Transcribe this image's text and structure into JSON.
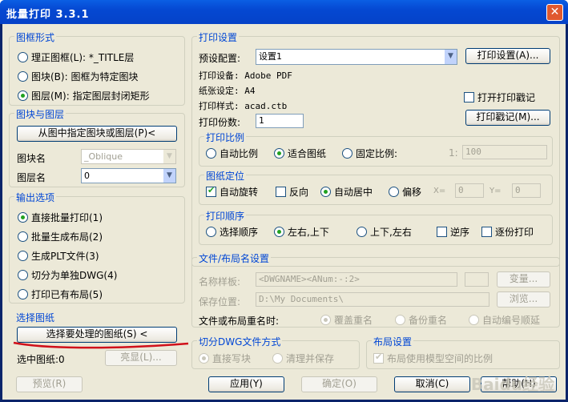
{
  "window": {
    "title": "批量打印 3.3.1",
    "close": "✕"
  },
  "frame": {
    "title": "图框形式",
    "options": [
      {
        "label": "理正图框(L): *_TITLE层",
        "checked": false
      },
      {
        "label": "图块(B): 图框为特定图块",
        "checked": false
      },
      {
        "label": "图层(M): 指定图层封闭矩形",
        "checked": true
      }
    ]
  },
  "block_layer": {
    "title": "图块与图层",
    "pick_button": "从图中指定图块或图层(P)<",
    "block_label": "图块名",
    "block_value": "_Oblique",
    "layer_label": "图层名",
    "layer_value": "0"
  },
  "output": {
    "title": "输出选项",
    "options": [
      {
        "label": "直接批量打印(1)",
        "checked": true
      },
      {
        "label": "批量生成布局(2)",
        "checked": false
      },
      {
        "label": "生成PLT文件(3)",
        "checked": false
      },
      {
        "label": "切分为单独DWG(4)",
        "checked": false
      },
      {
        "label": "打印已有布局(5)",
        "checked": false
      }
    ]
  },
  "select": {
    "title": "选择图纸",
    "select_button": "选择要处理的图纸(S) <",
    "selected_label": "选中图纸:0",
    "highlight_button": "亮显(L)..."
  },
  "print_settings": {
    "title": "打印设置",
    "preset_label": "预设配置:",
    "preset_value": "设置1",
    "settings_button": "打印设置(A)...",
    "device": "打印设备: Adobe PDF",
    "paper": "纸张设定: A4",
    "style": "打印样式: acad.ctb",
    "stamp_check": "打开打印戳记",
    "copies_label": "打印份数:",
    "copies_value": "1",
    "stamp_button": "打印戳记(M)..."
  },
  "scale": {
    "title": "打印比例",
    "auto": "自动比例",
    "fit": "适合图纸",
    "fixed": "固定比例:",
    "ratio_prefix": "1:",
    "ratio_value": "100"
  },
  "position": {
    "title": "图纸定位",
    "rotate": "自动旋转",
    "reverse": "反向",
    "center": "自动居中",
    "offset": "偏移",
    "x_label": "X=",
    "x_value": "0",
    "y_label": "Y=",
    "y_value": "0"
  },
  "order": {
    "title": "打印顺序",
    "select_order": "选择顺序",
    "lr_tb": "左右,上下",
    "tb_lr": "上下,左右",
    "reverse": "逆序",
    "one_by_one": "逐份打印"
  },
  "naming": {
    "title": "文件/布局名设置",
    "template_label": "名称样板:",
    "template_value": "<DWGNAME><ANum:-:2>",
    "var_button": "变量...",
    "save_label": "保存位置:",
    "save_value": "D:\\My Documents\\",
    "browse_button": "浏览...",
    "dup_label": "文件或布局重名时:",
    "dup_overwrite": "覆盖重名",
    "dup_backup": "备份重名",
    "dup_auto": "自动编号顺延"
  },
  "split": {
    "title": "切分DWG文件方式",
    "direct": "直接写块",
    "clean": "清理并保存"
  },
  "layout": {
    "title": "布局设置",
    "use_model": "布局使用模型空间的比例"
  },
  "footer": {
    "preview": "预览(R)",
    "apply": "应用(Y)",
    "ok": "确定(O)",
    "cancel": "取消(C)",
    "help": "帮助(H)"
  },
  "watermark": "Baidu经验",
  "colors": {
    "accent": "#0046d5",
    "title_bar": "#0548d2",
    "annotation": "#d0101a"
  }
}
